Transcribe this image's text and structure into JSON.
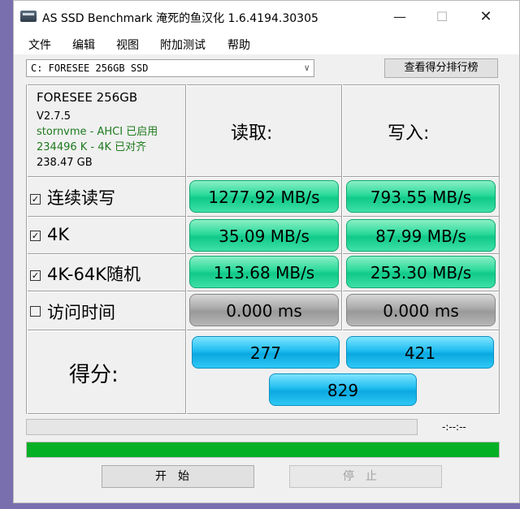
{
  "window": {
    "title": "AS SSD Benchmark 淹死的鱼汉化 1.6.4194.30305"
  },
  "menu": [
    "文件",
    "编辑",
    "视图",
    "附加测试",
    "帮助"
  ],
  "drive_select": {
    "value": "C: FORESEE 256GB SSD"
  },
  "rank_button": "查看得分排行榜",
  "info": {
    "model": "FORESEE 256GB",
    "firmware": "V2.7.5",
    "driver": "stornvme - AHCI 已启用",
    "alignment": "234496 K - 4K 已对齐",
    "capacity": "238.47 GB"
  },
  "headers": {
    "read": "读取:",
    "write": "写入:"
  },
  "rows": [
    {
      "label": "连续读写",
      "checked": true,
      "read": "1277.92 MB/s",
      "write": "793.55 MB/s"
    },
    {
      "label": "4K",
      "checked": true,
      "read": "35.09 MB/s",
      "write": "87.99 MB/s"
    },
    {
      "label": "4K-64K随机",
      "checked": true,
      "read": "113.68 MB/s",
      "write": "253.30 MB/s"
    },
    {
      "label": "访问时间",
      "checked": false,
      "read": "0.000 ms",
      "write": "0.000 ms"
    }
  ],
  "score": {
    "label": "得分:",
    "read": "277",
    "write": "421",
    "total": "829"
  },
  "progress": {
    "top_fraction": 0.0,
    "bottom_fraction": 1.0,
    "time_readout": "-:--:--"
  },
  "buttons": {
    "start": "开始",
    "stop": "停止"
  },
  "colors": {
    "result_green": "#2bd99b",
    "score_blue": "#1fbdf0",
    "progress_green": "#06b025"
  }
}
